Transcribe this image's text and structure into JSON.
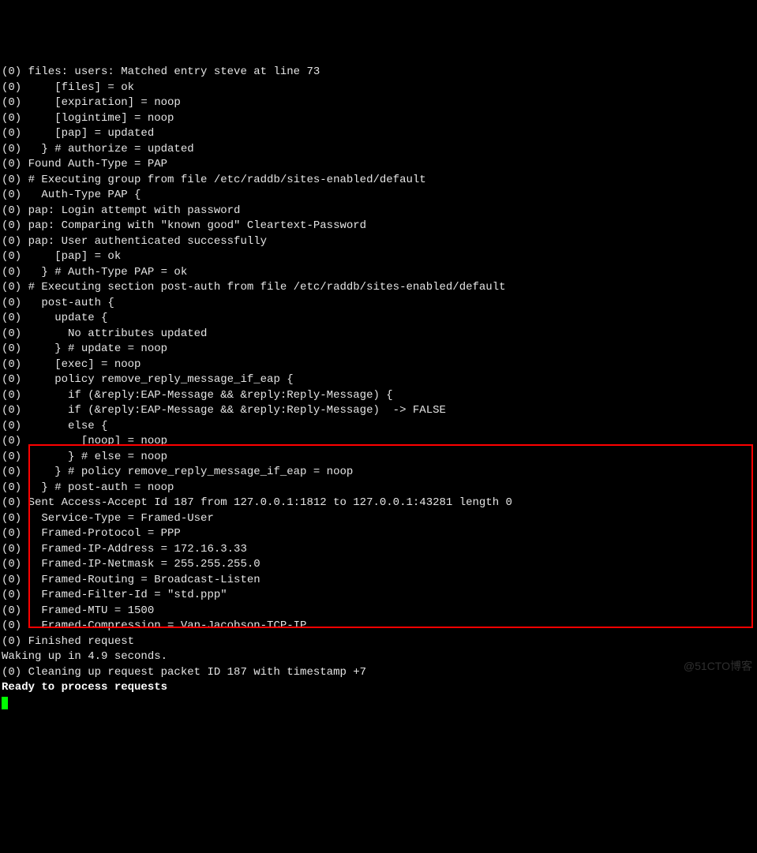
{
  "lines": [
    "(0) files: users: Matched entry steve at line 73",
    "(0)     [files] = ok",
    "(0)     [expiration] = noop",
    "(0)     [logintime] = noop",
    "(0)     [pap] = updated",
    "(0)   } # authorize = updated",
    "(0) Found Auth-Type = PAP",
    "(0) # Executing group from file /etc/raddb/sites-enabled/default",
    "(0)   Auth-Type PAP {",
    "(0) pap: Login attempt with password",
    "(0) pap: Comparing with \"known good\" Cleartext-Password",
    "(0) pap: User authenticated successfully",
    "(0)     [pap] = ok",
    "(0)   } # Auth-Type PAP = ok",
    "(0) # Executing section post-auth from file /etc/raddb/sites-enabled/default",
    "(0)   post-auth {",
    "(0)     update {",
    "(0)       No attributes updated",
    "(0)     } # update = noop",
    "(0)     [exec] = noop",
    "(0)     policy remove_reply_message_if_eap {",
    "(0)       if (&reply:EAP-Message && &reply:Reply-Message) {",
    "(0)       if (&reply:EAP-Message && &reply:Reply-Message)  -> FALSE",
    "(0)       else {",
    "(0)         [noop] = noop",
    "(0)       } # else = noop",
    "(0)     } # policy remove_reply_message_if_eap = noop",
    "(0)   } # post-auth = noop",
    "(0) Sent Access-Accept Id 187 from 127.0.0.1:1812 to 127.0.0.1:43281 length 0",
    "(0)   Service-Type = Framed-User",
    "(0)   Framed-Protocol = PPP",
    "(0)   Framed-IP-Address = 172.16.3.33",
    "(0)   Framed-IP-Netmask = 255.255.255.0",
    "(0)   Framed-Routing = Broadcast-Listen",
    "(0)   Framed-Filter-Id = \"std.ppp\"",
    "(0)   Framed-MTU = 1500",
    "(0)   Framed-Compression = Van-Jacobson-TCP-IP",
    "(0) Finished request",
    "Waking up in 4.9 seconds.",
    "(0) Cleaning up request packet ID 187 with timestamp +7"
  ],
  "ready_line": "Ready to process requests",
  "watermark": "@51CTO博客"
}
